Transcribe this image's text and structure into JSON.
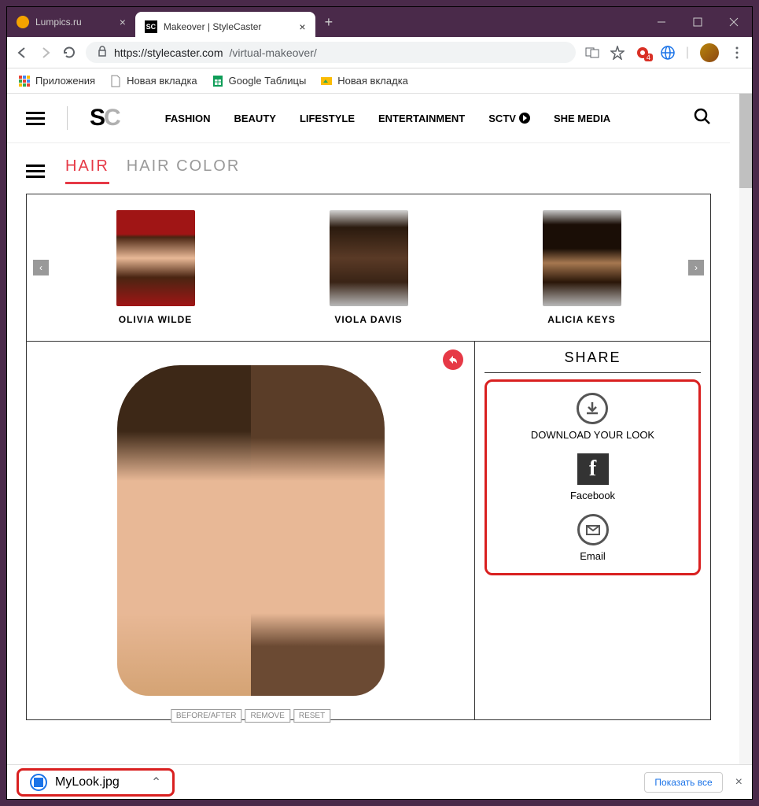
{
  "browser": {
    "tabs": [
      {
        "title": "Lumpics.ru",
        "active": false
      },
      {
        "title": "Makeover | StyleCaster",
        "active": true
      }
    ],
    "url_host": "https://stylecaster.com",
    "url_path": "/virtual-makeover/",
    "ext_badge": "4",
    "bookmarks": {
      "apps": "Приложения",
      "newtab1": "Новая вкладка",
      "sheets": "Google Таблицы",
      "newtab2": "Новая вкладка"
    }
  },
  "site": {
    "nav": {
      "fashion": "FASHION",
      "beauty": "BEAUTY",
      "lifestyle": "LIFESTYLE",
      "entertainment": "ENTERTAINMENT",
      "sctv": "SCTV",
      "shemedia": "SHE MEDIA"
    },
    "subtabs": {
      "hair": "HAIR",
      "haircolor": "HAIR COLOR"
    },
    "celebs": {
      "c1": "OLIVIA WILDE",
      "c2": "VIOLA DAVIS",
      "c3": "ALICIA KEYS"
    },
    "tools": {
      "before_after": "BEFORE/AFTER",
      "remove": "REMOVE",
      "reset": "RESET"
    },
    "share": {
      "title": "SHARE",
      "download": "DOWNLOAD YOUR LOOK",
      "facebook": "Facebook",
      "email": "Email"
    }
  },
  "downloads": {
    "file": "MyLook.jpg",
    "show_all": "Показать все"
  }
}
